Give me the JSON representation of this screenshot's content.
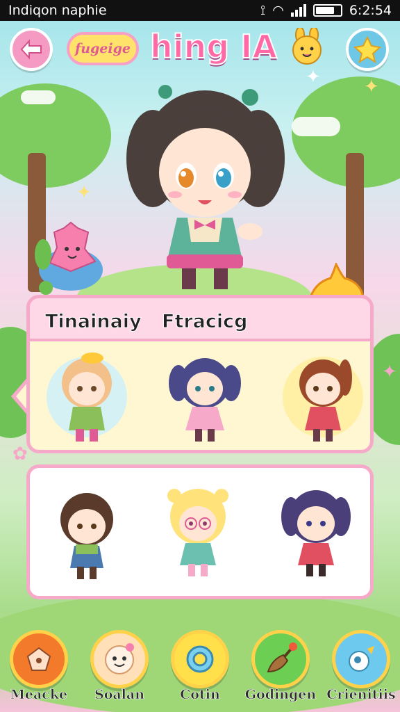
{
  "status_bar": {
    "app_name": "Indiqon naphie",
    "time": "6:2:54"
  },
  "header": {
    "pill_label": "fugeige",
    "title": "hing IA"
  },
  "hero": {
    "icon": "anime-girl-hero"
  },
  "panel_top": {
    "tabs": [
      {
        "label": "Tinainaiy"
      },
      {
        "label": "Ftracicg"
      }
    ],
    "characters": [
      {
        "icon": "blonde-girl-avatar"
      },
      {
        "icon": "purple-twintail-girl-avatar"
      },
      {
        "icon": "redhead-girl-avatar"
      }
    ]
  },
  "panel_bottom": {
    "characters": [
      {
        "icon": "brown-hair-girl-avatar"
      },
      {
        "icon": "blonde-glasses-girl-avatar"
      },
      {
        "icon": "purple-hair-girl-avatar"
      }
    ]
  },
  "bottom_nav": [
    {
      "label": "Meacke",
      "icon": "orange-fruit-icon",
      "color": "#f37a2a"
    },
    {
      "label": "Soalan",
      "icon": "smile-face-icon",
      "color": "#ffe0b8"
    },
    {
      "label": "Cotin",
      "icon": "ring-icon",
      "color": "#ffe04a"
    },
    {
      "label": "Godingen",
      "icon": "brush-icon",
      "color": "#6ccf54"
    },
    {
      "label": "Crienitiis",
      "icon": "bubble-icon",
      "color": "#6ec9ee"
    }
  ],
  "colors": {
    "accent": "#ff6aa6",
    "panel_border": "#f7a9c9",
    "panel_fill": "#fff7d2"
  }
}
